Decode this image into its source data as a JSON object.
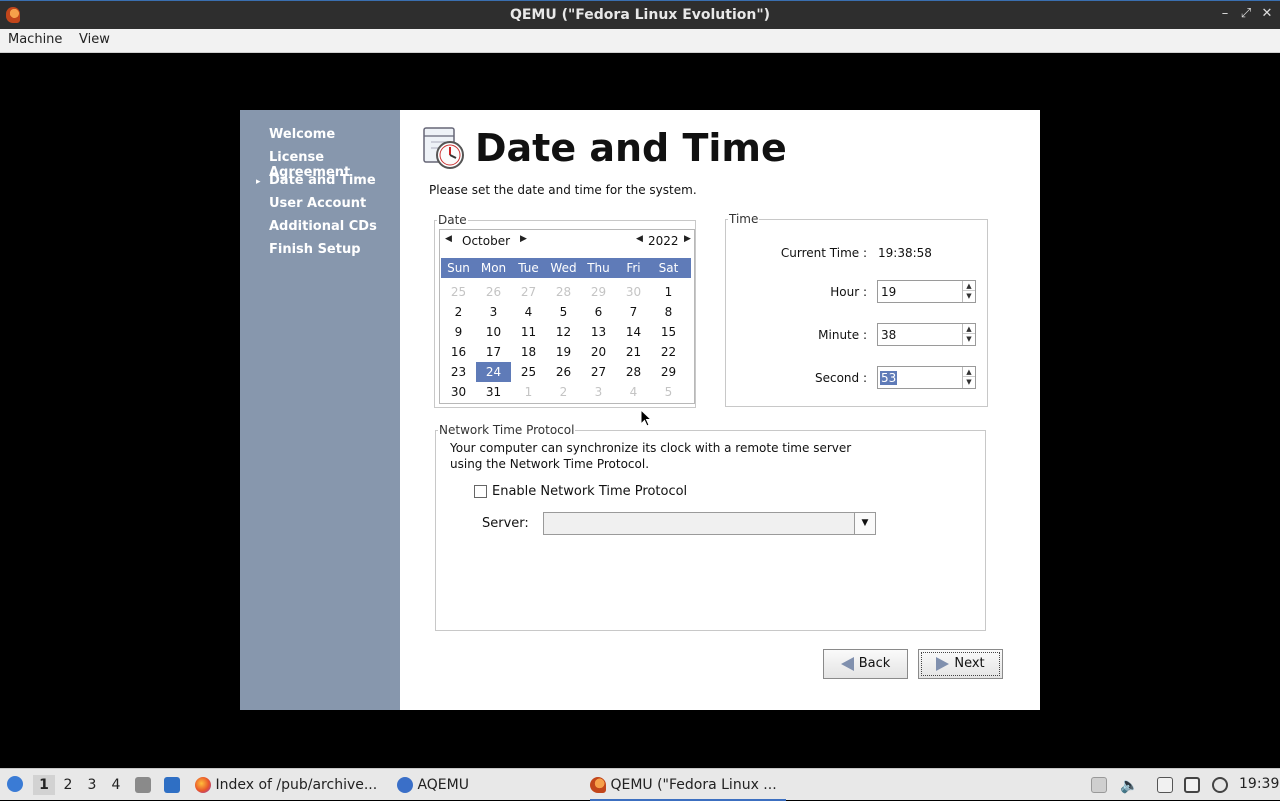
{
  "window": {
    "title": "QEMU (\"Fedora Linux Evolution\")",
    "controls": [
      "minimize",
      "maximize",
      "close"
    ]
  },
  "menubar": {
    "items": [
      "Machine",
      "View"
    ]
  },
  "guest": {
    "sidebar": {
      "items": [
        "Welcome",
        "License Agreement",
        "Date and Time",
        "User Account",
        "Additional CDs",
        "Finish Setup"
      ],
      "current": "Date and Time"
    },
    "heading": "Date and Time",
    "intro": "Please set the date and time for the system.",
    "date_group": {
      "legend": "Date",
      "month": "October",
      "year": "2022",
      "weekdays": [
        "Sun",
        "Mon",
        "Tue",
        "Wed",
        "Thu",
        "Fri",
        "Sat"
      ],
      "weeks": [
        [
          "25",
          "26",
          "27",
          "28",
          "29",
          "30",
          "1"
        ],
        [
          "2",
          "3",
          "4",
          "5",
          "6",
          "7",
          "8"
        ],
        [
          "9",
          "10",
          "11",
          "12",
          "13",
          "14",
          "15"
        ],
        [
          "16",
          "17",
          "18",
          "19",
          "20",
          "21",
          "22"
        ],
        [
          "23",
          "24",
          "25",
          "26",
          "27",
          "28",
          "29"
        ],
        [
          "30",
          "31",
          "1",
          "2",
          "3",
          "4",
          "5"
        ]
      ],
      "selected_day": "24"
    },
    "time_group": {
      "legend": "Time",
      "current_time_label": "Current Time :",
      "current_time": "19:38:58",
      "hour_label": "Hour :",
      "hour": "19",
      "minute_label": "Minute :",
      "minute": "38",
      "second_label": "Second :",
      "second": "53"
    },
    "ntp_group": {
      "legend": "Network Time Protocol",
      "line1": "Your computer can synchronize its clock with a remote time server",
      "line2": "using the Network Time Protocol.",
      "checkbox_label": "Enable Network Time Protocol",
      "checked": false,
      "server_label": "Server:",
      "server_value": ""
    },
    "buttons": {
      "back": "Back",
      "next": "Next"
    }
  },
  "taskbar": {
    "workspaces": [
      "1",
      "2",
      "3",
      "4"
    ],
    "active_workspace": "1",
    "tasks": [
      "Index of /pub/archive...",
      "AQEMU",
      "QEMU (\"Fedora Linux ..."
    ],
    "clock": "19:39"
  },
  "colors": {
    "sidebar": "#8797ad",
    "selection": "#5f7bb8",
    "titlebar": "#2e2e2e"
  }
}
